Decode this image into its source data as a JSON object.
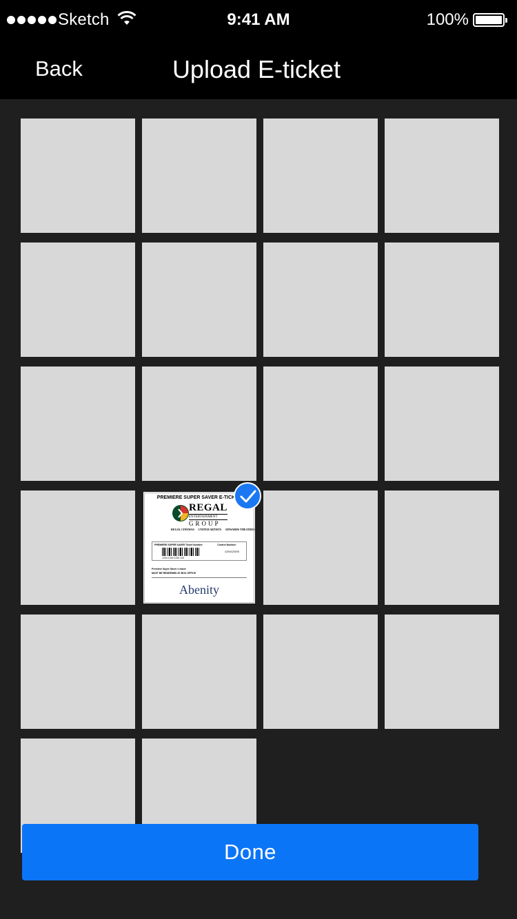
{
  "status_bar": {
    "carrier": "Sketch",
    "time": "9:41 AM",
    "battery_percent": "100%",
    "battery_level": 1.0
  },
  "nav": {
    "back_label": "Back",
    "title": "Upload E-ticket"
  },
  "grid": {
    "columns": 4,
    "total_items": 22,
    "selected_index": 13,
    "placeholder_color": "#d8d8d8"
  },
  "ticket": {
    "header": "PREMIERE SUPER SAVER E-TICKET",
    "brand_line1": "REGAL",
    "brand_line2": "ENTERTAINMENT",
    "brand_line3": "GROUP",
    "sub_brand_1": "REGAL CINEMAS",
    "sub_brand_2": "UNITED ARTISTS",
    "sub_brand_3": "EDWARDS THEATRES",
    "ticket_number_label": "PREMIERE SUPER SAVER Ticket Number:",
    "control_number_label": "Control Number:",
    "ticket_number": "1234 1234 1234 123",
    "control_number": "1234123/00",
    "fine_print_1": "Premiere Super Saver e-ticket",
    "fine_print_2": "MUST BE REDEEMED AT BOX OFFICE",
    "footer_brand": "Abenity"
  },
  "selection_icon": "checkmark-icon",
  "done_label": "Done",
  "colors": {
    "accent": "#0b75f8",
    "background": "#1f1f1f",
    "bar": "#000000"
  }
}
